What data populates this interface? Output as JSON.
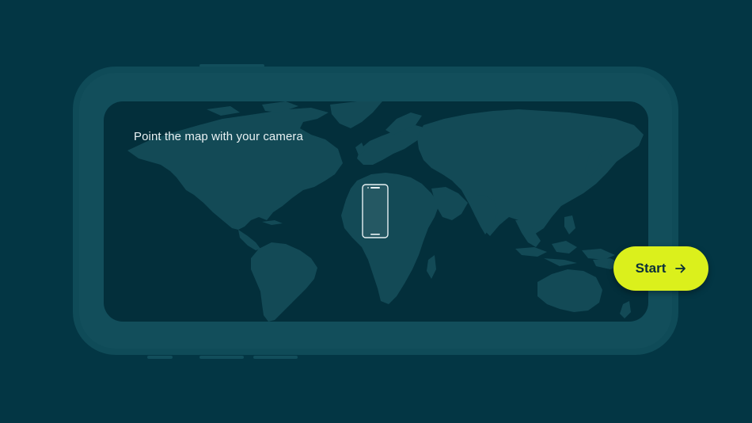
{
  "app": {
    "instruction_text": "Point the map with your camera",
    "start_button_label": "Start",
    "icons": {
      "start_button_icon": "arrow-right-icon",
      "device_icon": "smartphone-icon",
      "map": "world-map"
    },
    "colors": {
      "background": "#033644",
      "frame": "#0f4b58",
      "screen": "#032f3b",
      "continents": "#134a56",
      "accent": "#dbf01c",
      "text": "#e8f1f3"
    }
  }
}
